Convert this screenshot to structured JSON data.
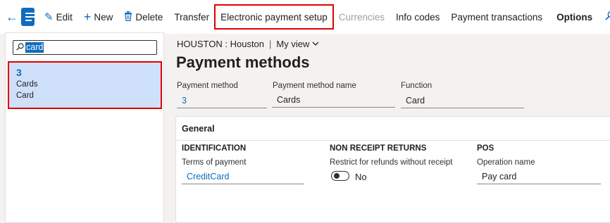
{
  "toolbar": {
    "edit": "Edit",
    "new": "New",
    "delete": "Delete",
    "transfer": "Transfer",
    "electronic_payment_setup": "Electronic payment setup",
    "currencies": "Currencies",
    "info_codes": "Info codes",
    "payment_transactions": "Payment transactions",
    "options": "Options"
  },
  "filter": {
    "value": "card"
  },
  "list": {
    "items": [
      {
        "id": "3",
        "name": "Cards",
        "function": "Card"
      }
    ]
  },
  "header": {
    "company": "HOUSTON : Houston",
    "view": "My view",
    "title": "Payment methods"
  },
  "fields": {
    "payment_method_label": "Payment method",
    "payment_method_value": "3",
    "payment_method_name_label": "Payment method name",
    "payment_method_name_value": "Cards",
    "function_label": "Function",
    "function_value": "Card"
  },
  "general": {
    "title": "General",
    "identification": {
      "heading": "IDENTIFICATION",
      "terms_label": "Terms of payment",
      "terms_value": "CreditCard"
    },
    "non_receipt": {
      "heading": "NON RECEIPT RETURNS",
      "restrict_label": "Restrict for refunds without receipt",
      "restrict_value": "No"
    },
    "pos": {
      "heading": "POS",
      "operation_label": "Operation name",
      "operation_value": "Pay card"
    }
  },
  "colors": {
    "accent": "#0f6cbd",
    "highlight": "#e00000",
    "selected_row": "#cfe0fb"
  }
}
